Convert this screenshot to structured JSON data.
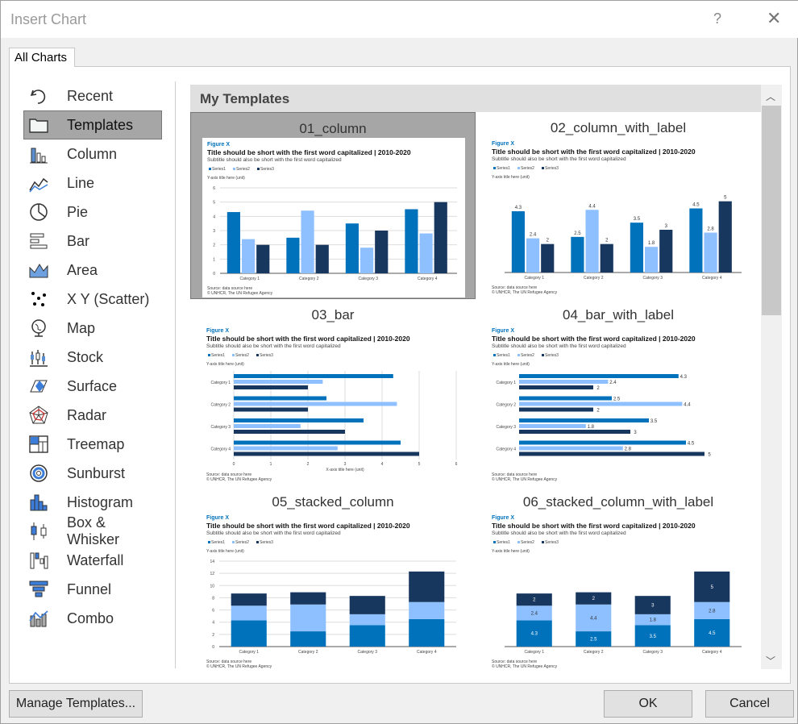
{
  "window": {
    "title": "Insert Chart",
    "help": "?",
    "close": "✕"
  },
  "tabs": [
    {
      "label": "All Charts"
    }
  ],
  "sidebar": {
    "items": [
      {
        "label": "Recent",
        "icon": "recent-icon"
      },
      {
        "label": "Templates",
        "icon": "folder-icon",
        "selected": true
      },
      {
        "label": "Column",
        "icon": "column-chart-icon"
      },
      {
        "label": "Line",
        "icon": "line-chart-icon"
      },
      {
        "label": "Pie",
        "icon": "pie-chart-icon"
      },
      {
        "label": "Bar",
        "icon": "bar-chart-icon"
      },
      {
        "label": "Area",
        "icon": "area-chart-icon"
      },
      {
        "label": "X Y (Scatter)",
        "icon": "scatter-chart-icon"
      },
      {
        "label": "Map",
        "icon": "map-chart-icon"
      },
      {
        "label": "Stock",
        "icon": "stock-chart-icon"
      },
      {
        "label": "Surface",
        "icon": "surface-chart-icon"
      },
      {
        "label": "Radar",
        "icon": "radar-chart-icon"
      },
      {
        "label": "Treemap",
        "icon": "treemap-chart-icon"
      },
      {
        "label": "Sunburst",
        "icon": "sunburst-chart-icon"
      },
      {
        "label": "Histogram",
        "icon": "histogram-chart-icon"
      },
      {
        "label": "Box & Whisker",
        "icon": "box-whisker-chart-icon"
      },
      {
        "label": "Waterfall",
        "icon": "waterfall-chart-icon"
      },
      {
        "label": "Funnel",
        "icon": "funnel-chart-icon"
      },
      {
        "label": "Combo",
        "icon": "combo-chart-icon"
      }
    ]
  },
  "main": {
    "header": "My Templates",
    "templates": [
      {
        "name": "01_column",
        "kind": "column",
        "selected": true
      },
      {
        "name": "02_column_with_label",
        "kind": "column_label"
      },
      {
        "name": "03_bar",
        "kind": "bar"
      },
      {
        "name": "04_bar_with_label",
        "kind": "bar_label"
      },
      {
        "name": "05_stacked_column",
        "kind": "stacked"
      },
      {
        "name": "06_stacked_column_with_label",
        "kind": "stacked_label"
      }
    ]
  },
  "sample_chart": {
    "figure": "Figure X",
    "title": "Title should be short with the first word capitalized | 2010-2020",
    "subtitle": "Subtitle should also be short with the first word capitalized",
    "y_axis_title": "Y-axis title here (unit)",
    "x_axis_title": "X-axis title here (unit)",
    "source": "Source: data source here",
    "credit": "© UNHCR, The UN Refugee Agency",
    "categories": [
      "Category 1",
      "Category 2",
      "Category 3",
      "Category 4"
    ],
    "series": [
      {
        "name": "Series1",
        "color": "#0072bc",
        "values": [
          4.3,
          2.5,
          3.5,
          4.5
        ]
      },
      {
        "name": "Series2",
        "color": "#8ebfff",
        "values": [
          2.4,
          4.4,
          1.8,
          2.8
        ]
      },
      {
        "name": "Series3",
        "color": "#18375f",
        "values": [
          2,
          2,
          3,
          5
        ]
      }
    ],
    "ylim": [
      0,
      6
    ],
    "stacked_ylim": [
      0,
      14
    ]
  },
  "footer": {
    "manage": "Manage Templates...",
    "ok": "OK",
    "cancel": "Cancel"
  }
}
